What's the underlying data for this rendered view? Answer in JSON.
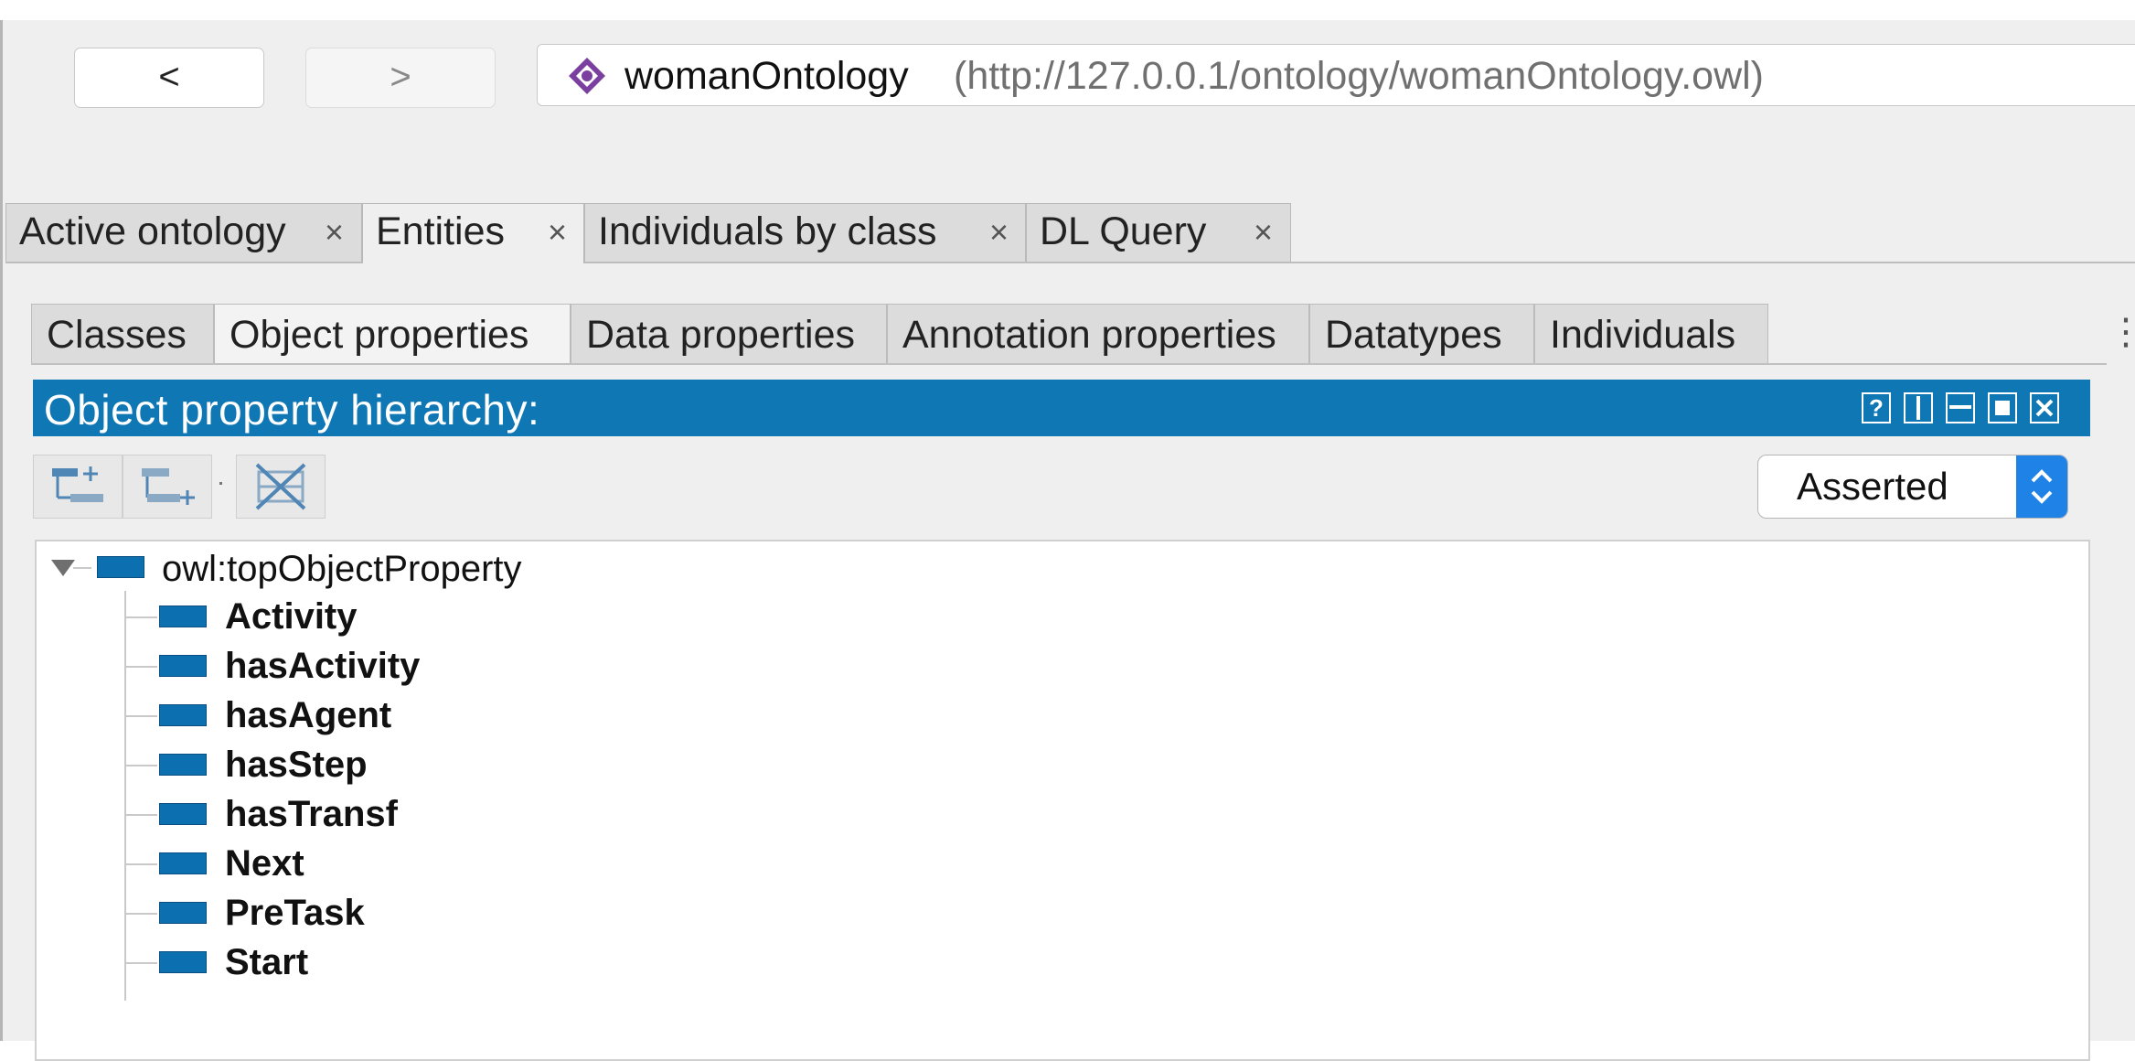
{
  "nav": {
    "back_label": "<",
    "forward_label": ">",
    "ontology_name": "womanOntology",
    "ontology_iri": "(http://127.0.0.1/ontology/womanOntology.owl)"
  },
  "main_tabs": [
    {
      "label": "Active ontology",
      "close": "×"
    },
    {
      "label": "Entities",
      "close": "×"
    },
    {
      "label": "Individuals by class",
      "close": "×"
    },
    {
      "label": "DL Query",
      "close": "×"
    }
  ],
  "sub_tabs": [
    {
      "label": "Classes"
    },
    {
      "label": "Object properties"
    },
    {
      "label": "Data properties"
    },
    {
      "label": "Annotation properties"
    },
    {
      "label": "Datatypes"
    },
    {
      "label": "Individuals"
    }
  ],
  "view": {
    "title": "Object property hierarchy:",
    "help_button": "?",
    "mode_select": "Asserted"
  },
  "tree": {
    "root": "owl:topObjectProperty",
    "children": [
      "Activity",
      "hasActivity",
      "hasAgent",
      "hasStep",
      "hasTransf",
      "Next",
      "PreTask",
      "Start"
    ]
  },
  "colors": {
    "header_blue": "#0f77b4",
    "property_icon": "#0c6fb0",
    "select_stepper": "#1f82e6",
    "ontology_icon": "#7b3fa0"
  },
  "icons": {
    "ontology": "ontology-diamond-icon",
    "add_sub": "add-sub-property-icon",
    "add_sibling": "add-sibling-property-icon",
    "delete": "delete-property-icon",
    "expand": "triangle-down-icon",
    "property": "object-property-icon"
  }
}
